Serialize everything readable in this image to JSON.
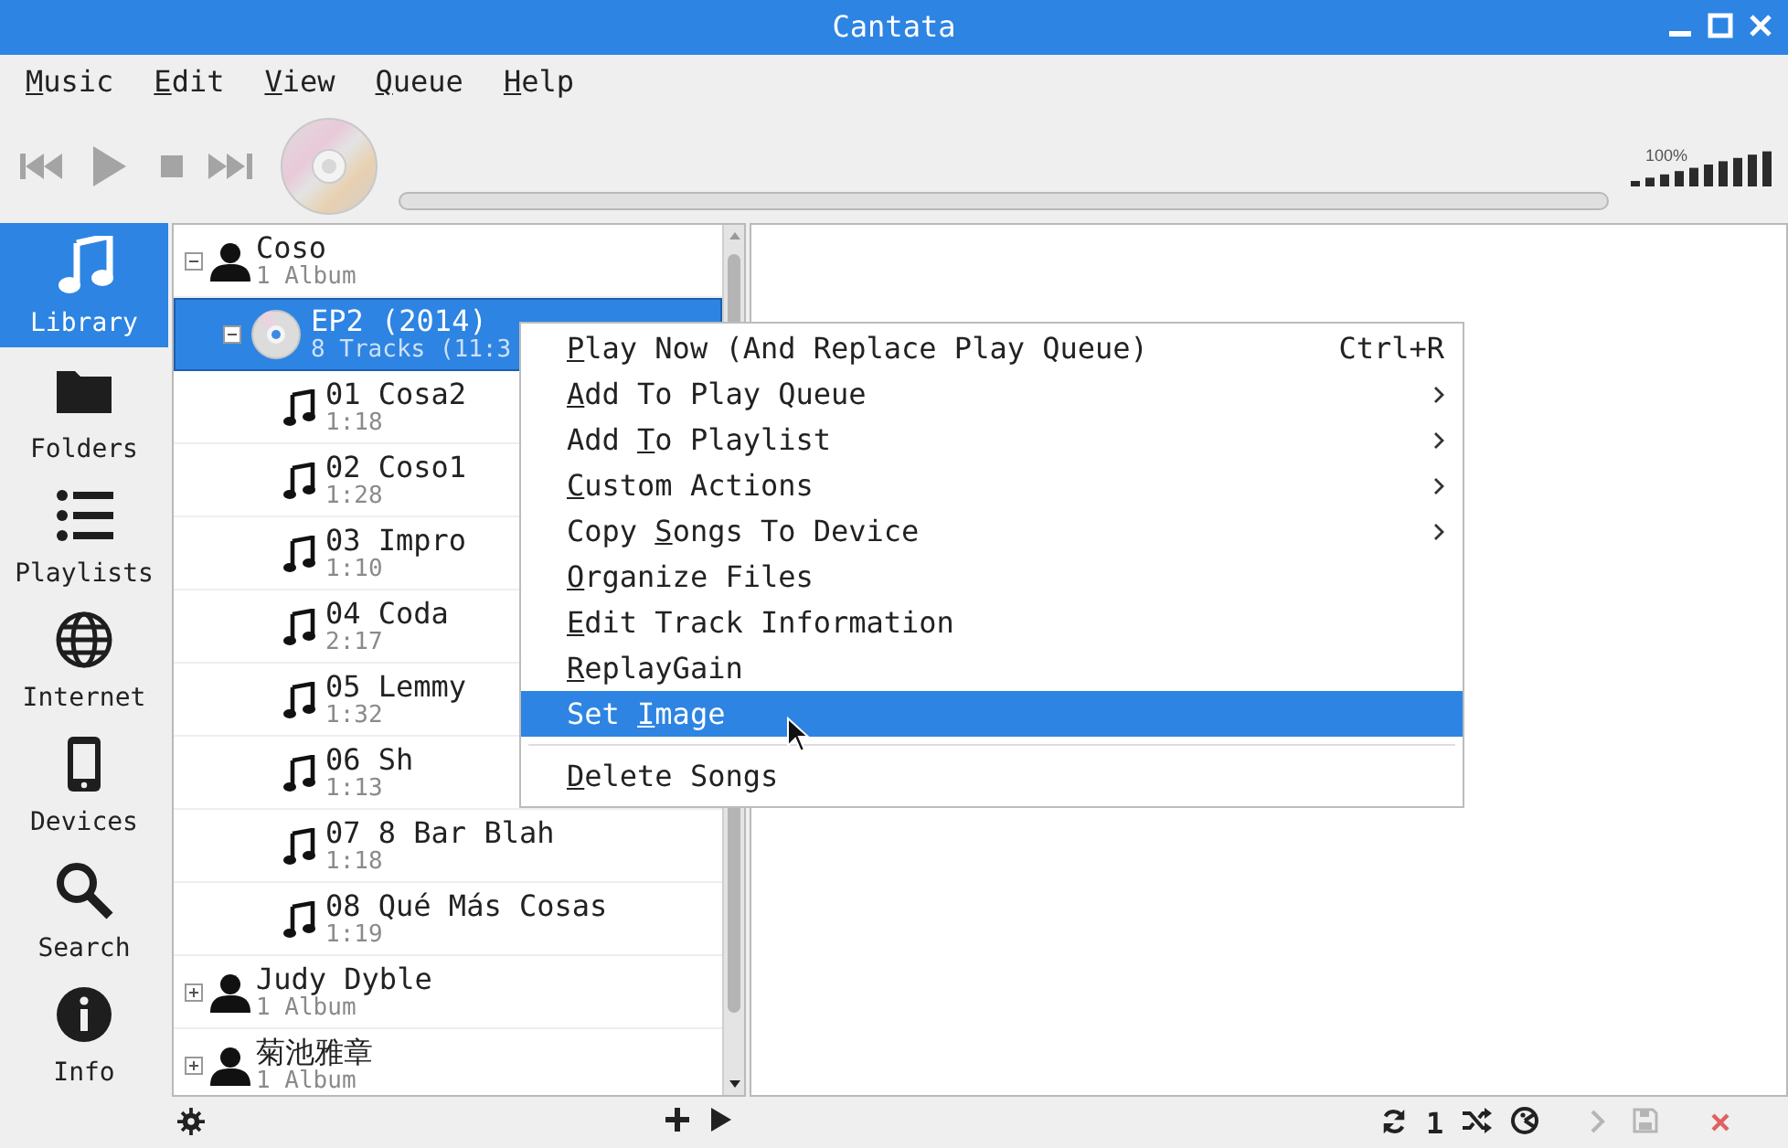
{
  "window": {
    "title": "Cantata"
  },
  "menubar": [
    {
      "key": "M",
      "post": "usic"
    },
    {
      "key": "E",
      "post": "dit"
    },
    {
      "key": "V",
      "post": "iew"
    },
    {
      "key": "Q",
      "post": "ueue"
    },
    {
      "key": "H",
      "post": "elp"
    }
  ],
  "player": {
    "progress": {
      "level": 0
    },
    "volume": {
      "reading": "100%",
      "level": 1
    }
  },
  "sidebar": {
    "items": [
      {
        "label": "Library",
        "selected": true
      },
      {
        "label": "Folders",
        "selected": false
      },
      {
        "label": "Playlists",
        "selected": false
      },
      {
        "label": "Internet",
        "selected": false
      },
      {
        "label": "Devices",
        "selected": false
      },
      {
        "label": "Search",
        "selected": false
      },
      {
        "label": "Info",
        "selected": false
      }
    ]
  },
  "library": [
    {
      "title": "Coso",
      "subtitle": "1 Album",
      "expanded": true,
      "selected": false,
      "children": [
        {
          "title": "EP2 (2014)",
          "subtitle": "8 Tracks (11:3",
          "expanded": true,
          "selected": true,
          "children": [
            {
              "title": "01 Cosa2",
              "subtitle": "1:18"
            },
            {
              "title": "02 Coso1",
              "subtitle": "1:28"
            },
            {
              "title": "03 Impro",
              "subtitle": "1:10"
            },
            {
              "title": "04 Coda",
              "subtitle": "2:17"
            },
            {
              "title": "05 Lemmy",
              "subtitle": "1:32"
            },
            {
              "title": "06 Sh",
              "subtitle": "1:13"
            },
            {
              "title": "07 8 Bar Blah",
              "subtitle": "1:18"
            },
            {
              "title": "08 Qué Más Cosas",
              "subtitle": "1:19"
            }
          ]
        }
      ]
    },
    {
      "title": "Judy Dyble",
      "subtitle": "1 Album",
      "expanded": false,
      "selected": false
    },
    {
      "title": "菊池雅章",
      "subtitle": "1 Album",
      "expanded": false,
      "selected": false
    }
  ],
  "context_menu": {
    "items": [
      {
        "key": "P",
        "post": "lay Now (And Replace Play Queue)",
        "shortcut": "Ctrl+R",
        "submenu": false,
        "selected": false
      },
      {
        "key": "A",
        "post": "dd To Play Queue",
        "submenu": true,
        "selected": false
      },
      {
        "pre": "Add ",
        "key": "T",
        "post": "o Playlist",
        "submenu": true,
        "selected": false
      },
      {
        "key": "C",
        "post": "ustom Actions",
        "submenu": true,
        "selected": false
      },
      {
        "pre": "Copy ",
        "key": "S",
        "post": "ongs To Device",
        "submenu": true,
        "selected": false
      },
      {
        "key": "O",
        "post": "rganize Files",
        "submenu": false,
        "selected": false
      },
      {
        "key": "E",
        "post": "dit Track Information",
        "submenu": false,
        "selected": false
      },
      {
        "key": "R",
        "post": "eplayGain",
        "submenu": false,
        "selected": false
      },
      {
        "pre": "Set ",
        "key": "I",
        "post": "mage",
        "submenu": false,
        "selected": true
      },
      {
        "kind": "separator"
      },
      {
        "key": "D",
        "post": "elete Songs",
        "submenu": false,
        "selected": false
      }
    ]
  },
  "bottom_bar": {
    "repeat_count": "1"
  }
}
